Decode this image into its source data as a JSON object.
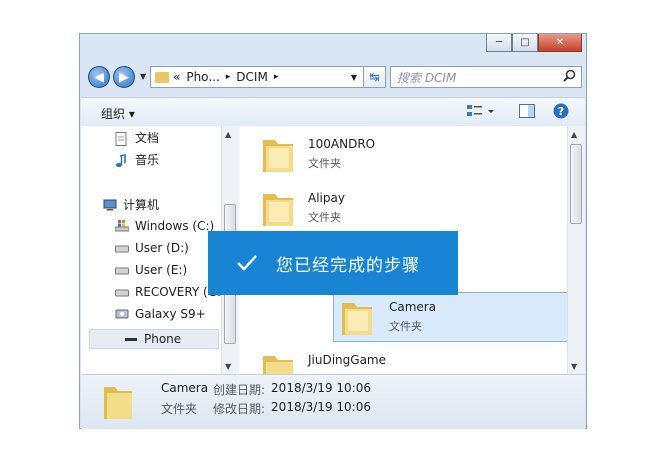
{
  "window": {
    "caption_buttons": {
      "minimize": "─",
      "maximize": "□",
      "close": "✕"
    }
  },
  "navbar": {
    "back_glyph": "◀",
    "forward_glyph": "▶",
    "breadcrumb": [
      {
        "label": "«"
      },
      {
        "label": "Pho..."
      },
      {
        "label": "▸"
      },
      {
        "label": "DCIM"
      },
      {
        "label": "▸"
      }
    ],
    "dropdown_glyph": "▼",
    "refresh_glyph": "↹",
    "search_placeholder": "搜索 DCIM",
    "search_icon": "magnifier-icon"
  },
  "toolbar": {
    "organize_label": "组织 ▾",
    "view_icon": "view-menu-icon",
    "preview_icon": "preview-pane-icon",
    "help_icon": "help-icon",
    "help_glyph": "?"
  },
  "sidebar": {
    "items": [
      {
        "label": "文档",
        "icon": "document-icon"
      },
      {
        "label": "音乐",
        "icon": "music-icon"
      },
      {
        "label": "计算机",
        "icon": "computer-icon"
      },
      {
        "label": "Windows (C:)",
        "icon": "windows-drive-icon"
      },
      {
        "label": "User (D:)",
        "icon": "drive-icon"
      },
      {
        "label": "User (E:)",
        "icon": "drive-icon"
      },
      {
        "label": "RECOVERY (G:",
        "icon": "drive-icon"
      },
      {
        "label": "Galaxy S9+",
        "icon": "phone-device-icon"
      },
      {
        "label": "Phone",
        "icon": "phone-icon"
      }
    ]
  },
  "files": [
    {
      "name": "100ANDRO",
      "type": "文件夹"
    },
    {
      "name": "Alipay",
      "type": "文件夹"
    },
    {
      "name": "Camera",
      "type": "文件夹",
      "selected": true
    },
    {
      "name": "JiuDingGame",
      "type": ""
    }
  ],
  "details": {
    "name": "Camera",
    "type": "文件夹",
    "created_label": "创建日期:",
    "created_value": "2018/3/19 10:06",
    "modified_label": "修改日期:",
    "modified_value": "2018/3/19 10:06"
  },
  "toast": {
    "message": "您已经完成的步骤",
    "icon": "checkmark-icon"
  },
  "colors": {
    "toast_bg": "#1a84d4",
    "folder": "#e8c864",
    "selection": "#d9ebfb"
  }
}
